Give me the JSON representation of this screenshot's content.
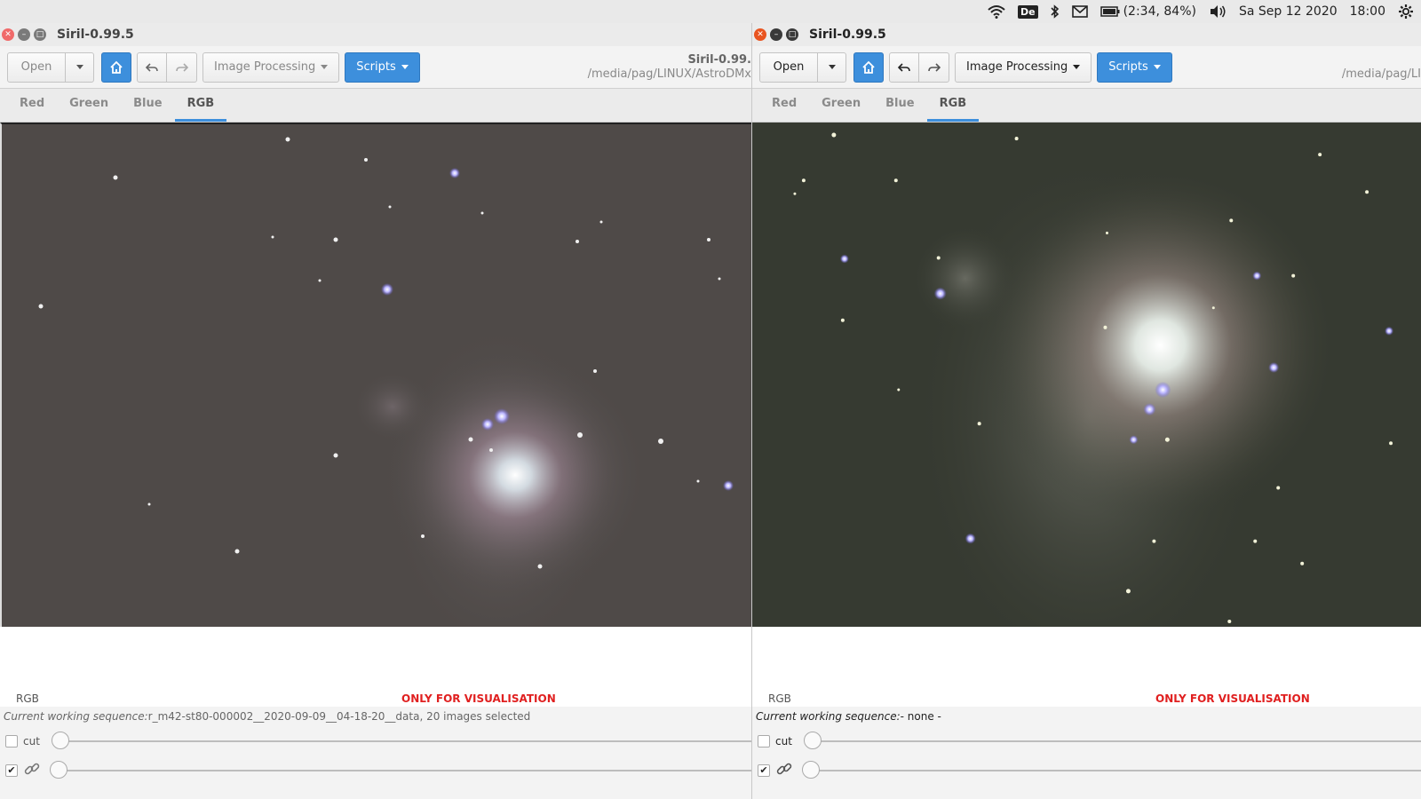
{
  "system_tray": {
    "keyboard_layout": "De",
    "battery": "(2:34, 84%)",
    "date": "Sa Sep 12 2020",
    "time": "18:00"
  },
  "windows": [
    {
      "title": "Siril-0.99.5",
      "toolbar": {
        "open_label": "Open",
        "image_processing_label": "Image Processing",
        "scripts_label": "Scripts",
        "path_title": "Siril-0.99.",
        "path": "/media/pag/LINUX/AstroDMx"
      },
      "tabs": [
        "Red",
        "Green",
        "Blue",
        "RGB"
      ],
      "active_tab": "RGB",
      "channel_label": "RGB",
      "visualisation_label": "ONLY FOR VISUALISATION",
      "sequence_prefix": "Current working sequence:",
      "sequence_value": "r_m42-st80-000002__2020-09-09__04-18-20__data, 20 images selected",
      "cut_label": "cut"
    },
    {
      "title": "Siril-0.99.5",
      "toolbar": {
        "open_label": "Open",
        "image_processing_label": "Image Processing",
        "scripts_label": "Scripts",
        "path_title": "",
        "path": "/media/pag/LI"
      },
      "tabs": [
        "Red",
        "Green",
        "Blue",
        "RGB"
      ],
      "active_tab": "RGB",
      "channel_label": "RGB",
      "visualisation_label": "ONLY FOR VISUALISATION",
      "sequence_prefix": "Current working sequence:",
      "sequence_value": "- none -",
      "cut_label": "cut"
    }
  ],
  "colors": {
    "accent": "#3d8fdc",
    "warning_text": "#e02020",
    "left_image_bg": "#4f4a48",
    "right_image_bg": "#363a31"
  }
}
